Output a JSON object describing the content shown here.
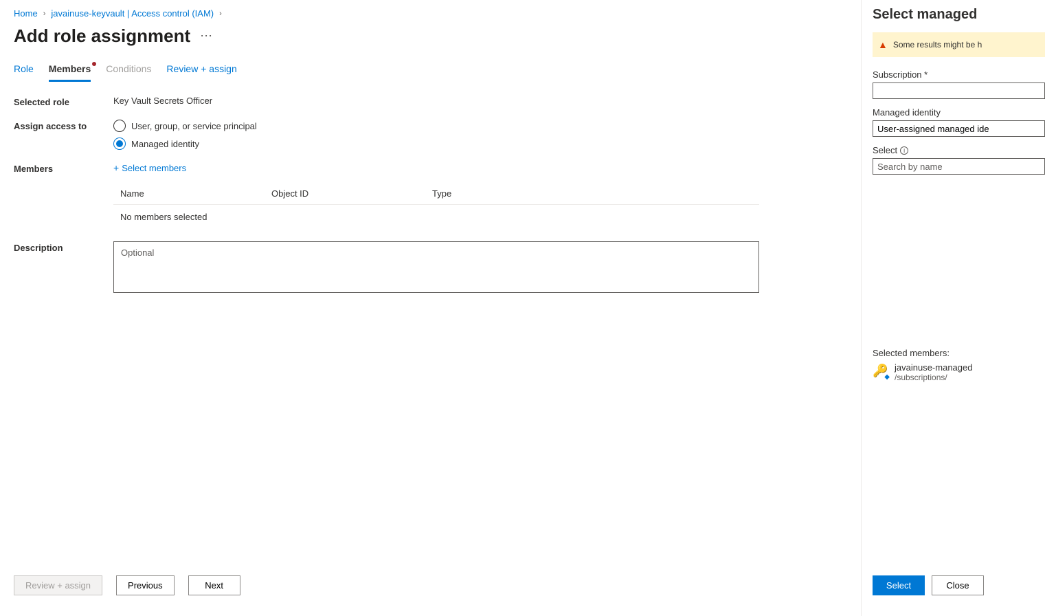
{
  "breadcrumb": {
    "home": "Home",
    "item1": "javainuse-keyvault | Access control (IAM)"
  },
  "page_title": "Add role assignment",
  "tabs": {
    "role": "Role",
    "members": "Members",
    "conditions": "Conditions",
    "review": "Review + assign"
  },
  "form": {
    "selected_role_label": "Selected role",
    "selected_role_value": "Key Vault Secrets Officer",
    "assign_access_label": "Assign access to",
    "radio_user": "User, group, or service principal",
    "radio_managed": "Managed identity",
    "members_label": "Members",
    "select_members_link": "Select members",
    "table_name": "Name",
    "table_objectid": "Object ID",
    "table_type": "Type",
    "no_members": "No members selected",
    "description_label": "Description",
    "description_placeholder": "Optional"
  },
  "footer": {
    "review": "Review + assign",
    "previous": "Previous",
    "next": "Next"
  },
  "panel": {
    "title": "Select managed",
    "warning": "Some results might be h",
    "subscription_label": "Subscription *",
    "managed_identity_label": "Managed identity",
    "managed_identity_value": "User-assigned managed ide",
    "select_label": "Select",
    "search_placeholder": "Search by name",
    "selected_members_label": "Selected members:",
    "member_name": "javainuse-managed",
    "member_path": "/subscriptions/",
    "select_btn": "Select",
    "close_btn": "Close"
  }
}
